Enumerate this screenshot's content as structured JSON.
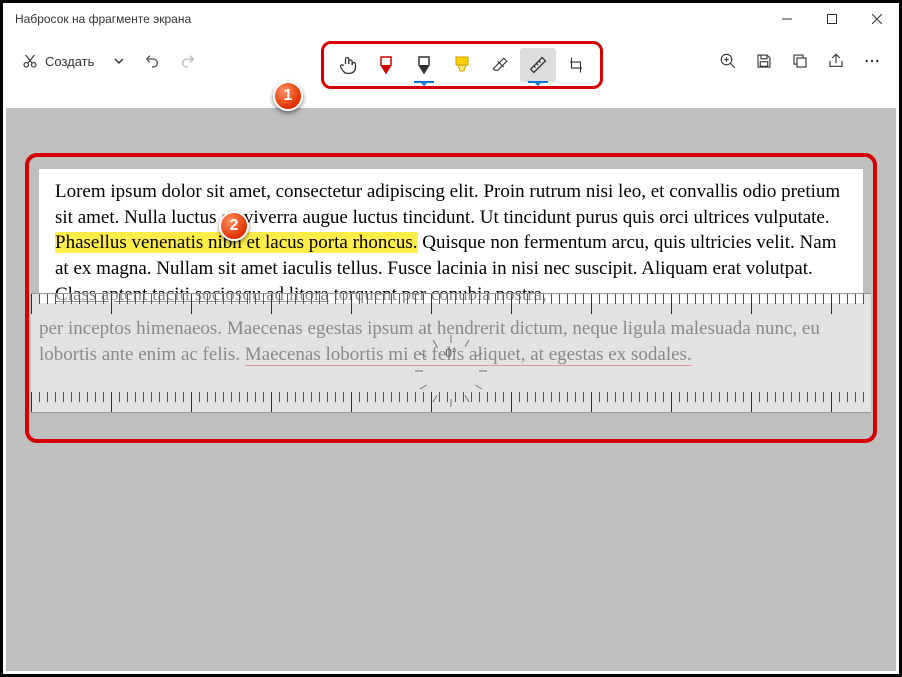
{
  "window": {
    "title": "Набросок на фрагменте экрана"
  },
  "toolbar": {
    "create_label": "Создать"
  },
  "ruler": {
    "angle": "0°"
  },
  "callouts": {
    "one": "1",
    "two": "2"
  },
  "document": {
    "p1a": "Lorem ipsum dolor sit amet, consectetur adipiscing elit. Proin rutrum nisi leo, et convallis odio pretium sit amet. Nulla luctus ex viverra augue luctus tincidunt. Ut tincidunt purus quis orci ultrices vulputate. ",
    "hl": "Phasellus venenatis nibh et lacus porta rhoncus.",
    "p1b": " Quisque non fermentum arcu, quis ultricies velit. Nam at ex magna. Nullam sit amet iaculis tellus. Fusce lacinia in nisi nec suscipit. Aliquam erat volutpat. ",
    "ul": "Class aptent taciti sociosqu ad litora",
    "p1c": " torquent per conubia nostra,",
    "faded_a": "per inceptos himenaeos. Maecenas egestas ipsum at hendrerit dictum, neque ligula malesuada nunc, eu lobortis ante enim ac felis. ",
    "faded_ul": "Maecenas lobortis mi et felis aliquet, at egestas ex sodales."
  }
}
